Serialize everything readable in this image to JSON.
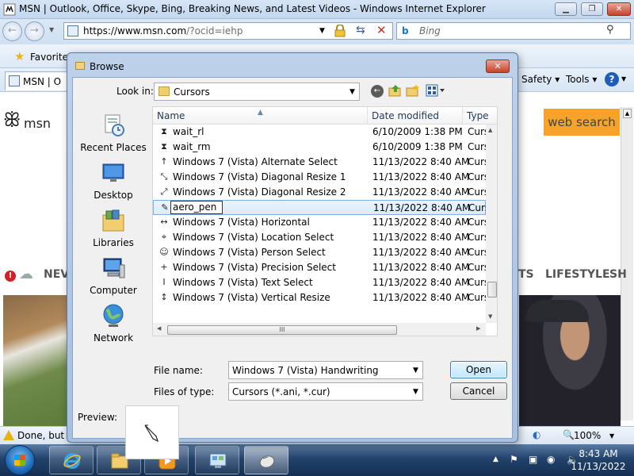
{
  "ie": {
    "title": "MSN | Outlook, Office, Skype, Bing, Breaking News, and Latest Videos - Windows Internet Explorer",
    "address_main": "https://www.msn.com",
    "address_query": "/?ocid=iehp",
    "search_placeholder": "Bing",
    "favorites_label": "Favorites",
    "tab_label": "MSN | O",
    "safety_label": "Safety ▾",
    "tools_label": "Tools ▾",
    "status_text": "Done, but w",
    "zoom_label": "100%"
  },
  "page": {
    "logo_text": "msn",
    "web_search_label": "web search",
    "nav_news": "NEV",
    "nav_ts": "TS",
    "nav_lifestyle": "LIFESTYLE",
    "nav_sh": "SH"
  },
  "taskbar": {
    "time": "8:43 AM",
    "date": "11/13/2022"
  },
  "dialog": {
    "title": "Browse",
    "look_in_label": "Look in:",
    "look_in_value": "Cursors",
    "places": [
      {
        "label": "Recent Places",
        "icon": "recent-places-icon"
      },
      {
        "label": "Desktop",
        "icon": "desktop-icon"
      },
      {
        "label": "Libraries",
        "icon": "libraries-icon"
      },
      {
        "label": "Computer",
        "icon": "computer-icon"
      },
      {
        "label": "Network",
        "icon": "network-icon"
      }
    ],
    "columns": {
      "name": "Name",
      "date": "Date modified",
      "type": "Type"
    },
    "rows": [
      {
        "name": "wait_rl",
        "date": "6/10/2009 1:38 PM",
        "type": "Cursor",
        "icon": "busy-cursor-icon"
      },
      {
        "name": "wait_rm",
        "date": "6/10/2009 1:38 PM",
        "type": "Cursor",
        "icon": "busy-cursor-icon"
      },
      {
        "name": "Windows 7 (Vista) Alternate Select",
        "date": "11/13/2022 8:40 AM",
        "type": "Cursor",
        "icon": "alternate-select-cursor-icon"
      },
      {
        "name": "Windows 7 (Vista) Diagonal Resize 1",
        "date": "11/13/2022 8:40 AM",
        "type": "Cursor",
        "icon": "diagonal-resize-cursor-icon"
      },
      {
        "name": "Windows 7 (Vista) Diagonal Resize 2",
        "date": "11/13/2022 8:40 AM",
        "type": "Cursor",
        "icon": "diagonal-resize-cursor-icon"
      },
      {
        "name": "aero_pen",
        "date": "11/13/2022 8:40 AM",
        "type": "Cursor",
        "icon": "pen-cursor-icon"
      },
      {
        "name": "Windows 7 (Vista) Horizontal",
        "date": "11/13/2022 8:40 AM",
        "type": "Cursor",
        "icon": "horizontal-resize-cursor-icon"
      },
      {
        "name": "Windows 7 (Vista) Location Select",
        "date": "11/13/2022 8:40 AM",
        "type": "Cursor",
        "icon": "location-select-cursor-icon"
      },
      {
        "name": "Windows 7 (Vista) Person Select",
        "date": "11/13/2022 8:40 AM",
        "type": "Cursor",
        "icon": "person-select-cursor-icon"
      },
      {
        "name": "Windows 7 (Vista) Precision Select",
        "date": "11/13/2022 8:40 AM",
        "type": "Cursor",
        "icon": "precision-select-cursor-icon"
      },
      {
        "name": "Windows 7 (Vista) Text Select",
        "date": "11/13/2022 8:40 AM",
        "type": "Cursor",
        "icon": "text-select-cursor-icon"
      },
      {
        "name": "Windows 7 (Vista) Vertical Resize",
        "date": "11/13/2022 8:40 AM",
        "type": "Cursor",
        "icon": "vertical-resize-cursor-icon"
      }
    ],
    "file_name_label": "File name:",
    "file_name_value": "Windows 7 (Vista) Handwriting",
    "files_of_type_label": "Files of type:",
    "files_of_type_value": "Cursors (*.ani, *.cur)",
    "open_label": "Open",
    "cancel_label": "Cancel",
    "preview_label": "Preview:",
    "hscroll_grip": "III"
  },
  "colors": {
    "dialog_frame": "#bdd1ea",
    "selection_border": "#84acdd",
    "web_search_accent": "#f5a32a"
  }
}
